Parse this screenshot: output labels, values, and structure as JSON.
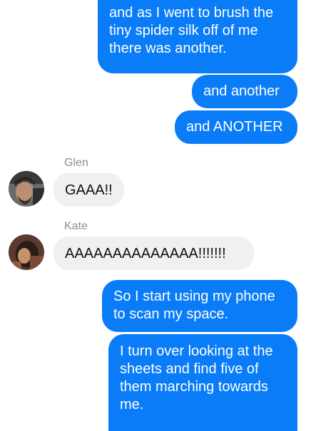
{
  "colors": {
    "outgoing_bubble": "#0a7cf7",
    "incoming_bubble": "#f0f0f0",
    "sender_name": "#8e8e93"
  },
  "messages": {
    "m1": {
      "direction": "outgoing",
      "text": "and as I went to brush the\ntiny spider silk off of me\nthere was another."
    },
    "m2": {
      "direction": "outgoing",
      "text": "and another"
    },
    "m3": {
      "direction": "outgoing",
      "text": "and ANOTHER"
    },
    "m4": {
      "direction": "incoming",
      "sender": "Glen",
      "avatar": "glen-avatar",
      "text": "GAAA!!"
    },
    "m5": {
      "direction": "incoming",
      "sender": "Kate",
      "avatar": "kate-avatar",
      "text": "AAAAAAAAAAAAAA!!!!!!!"
    },
    "m6": {
      "direction": "outgoing",
      "text": "So I start using my phone\nto scan my space."
    },
    "m7": {
      "direction": "outgoing",
      "text": "I turn over looking at the\nsheets and find five of\nthem marching towards\nme."
    }
  }
}
